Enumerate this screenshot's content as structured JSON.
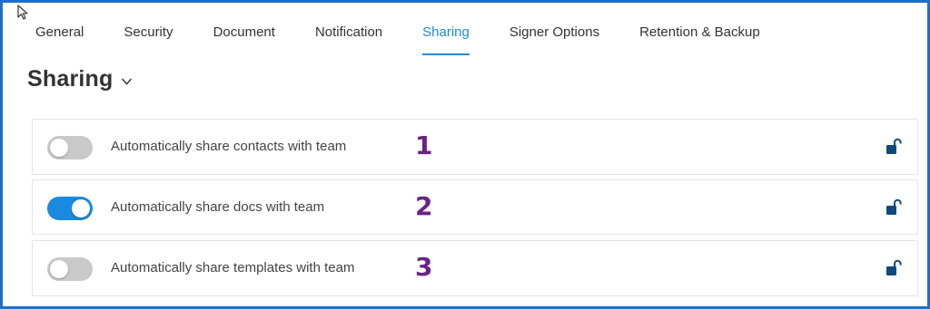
{
  "tabs": [
    {
      "label": "General",
      "active": false
    },
    {
      "label": "Security",
      "active": false
    },
    {
      "label": "Document",
      "active": false
    },
    {
      "label": "Notification",
      "active": false
    },
    {
      "label": "Sharing",
      "active": true
    },
    {
      "label": "Signer Options",
      "active": false
    },
    {
      "label": "Retention & Backup",
      "active": false
    }
  ],
  "section": {
    "title": "Sharing",
    "chevron_icon": "chevron-down-icon"
  },
  "settings": [
    {
      "label": "Automatically share contacts with team",
      "enabled": false,
      "number": "1",
      "lock_icon": "unlocked-padlock-icon"
    },
    {
      "label": "Automatically share docs with team",
      "enabled": true,
      "number": "2",
      "lock_icon": "unlocked-padlock-icon"
    },
    {
      "label": "Automatically share templates with team",
      "enabled": false,
      "number": "3",
      "lock_icon": "unlocked-padlock-icon"
    }
  ],
  "colors": {
    "accent": "#1a8ae0",
    "frame": "#1e6fc9",
    "toggle_off": "#c9c9c9",
    "annotation_number": "#6a2288",
    "lock": "#0f4a7a"
  }
}
